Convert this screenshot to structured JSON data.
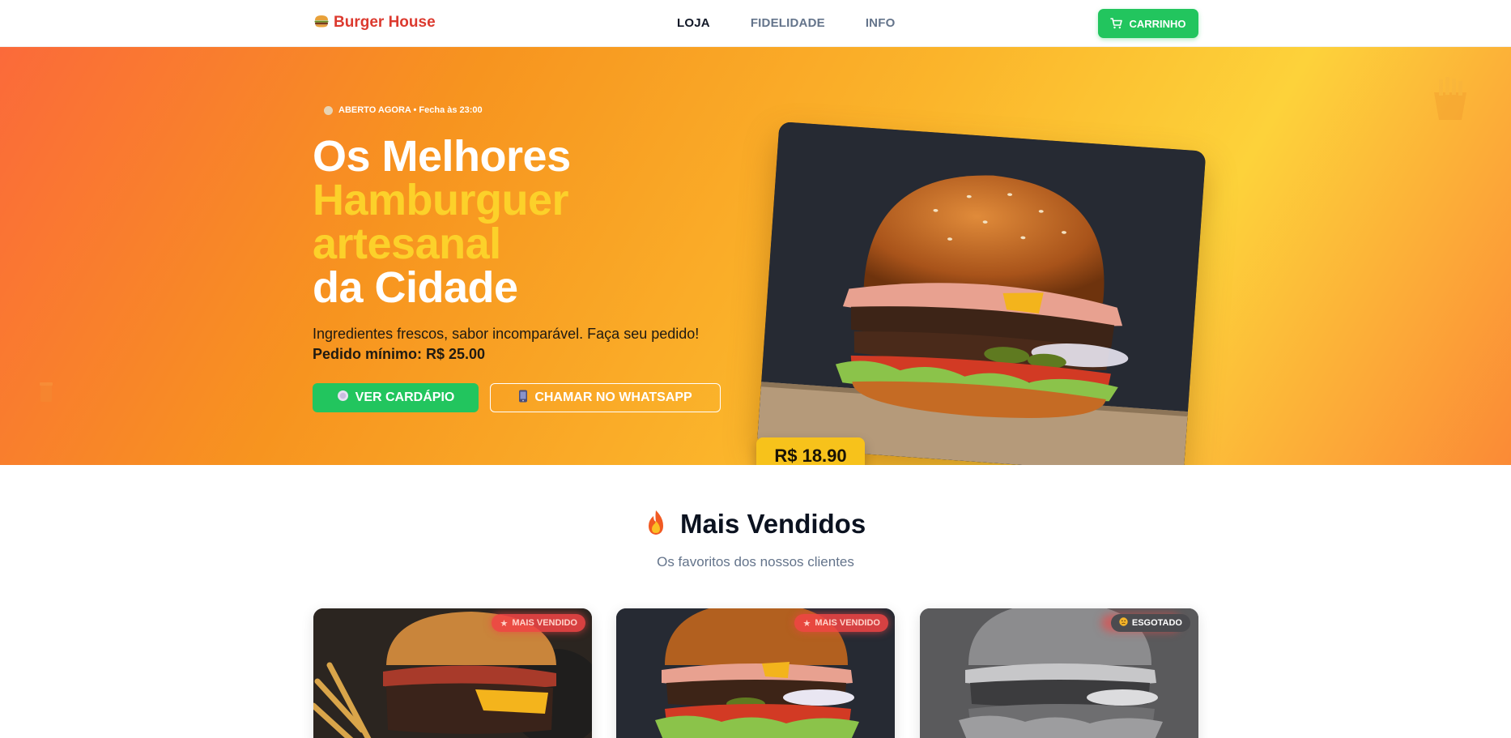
{
  "header": {
    "brand": "Burger House",
    "brand_icon": "burger-icon",
    "nav": [
      {
        "label": "LOJA",
        "active": true
      },
      {
        "label": "FIDELIDADE",
        "active": false
      },
      {
        "label": "INFO",
        "active": false
      }
    ],
    "cart_label": "CARRINHO",
    "cart_icon": "cart-icon"
  },
  "hero": {
    "status": "ABERTO AGORA • Fecha às 23:00",
    "title_line1": "Os Melhores",
    "title_line2": "Hamburguer",
    "title_line3": "artesanal",
    "title_line4": "da Cidade",
    "subtitle": "Ingredientes frescos, sabor incomparável. Faça seu pedido!",
    "min_order": "Pedido mínimo: R$ 25.00",
    "menu_button": "VER CARDÁPIO",
    "whatsapp_button": "CHAMAR NO WHATSAPP",
    "price": "R$ 18.90"
  },
  "section": {
    "title": "Mais Vendidos",
    "subtitle": "Os favoritos dos nossos clientes",
    "cards": [
      {
        "badge": "MAIS VENDIDO",
        "badge_icon": "star-icon"
      },
      {
        "badge": "MAIS VENDIDO",
        "badge_icon": "star-icon"
      },
      {
        "badge": "ESGOTADO",
        "badge_icon": "sad-face-icon"
      }
    ]
  },
  "colors": {
    "accent_green": "#22c55e",
    "brand_red": "#dc3a2f",
    "price_yellow": "#f7c21b",
    "highlight_yellow": "#fcd12a"
  }
}
